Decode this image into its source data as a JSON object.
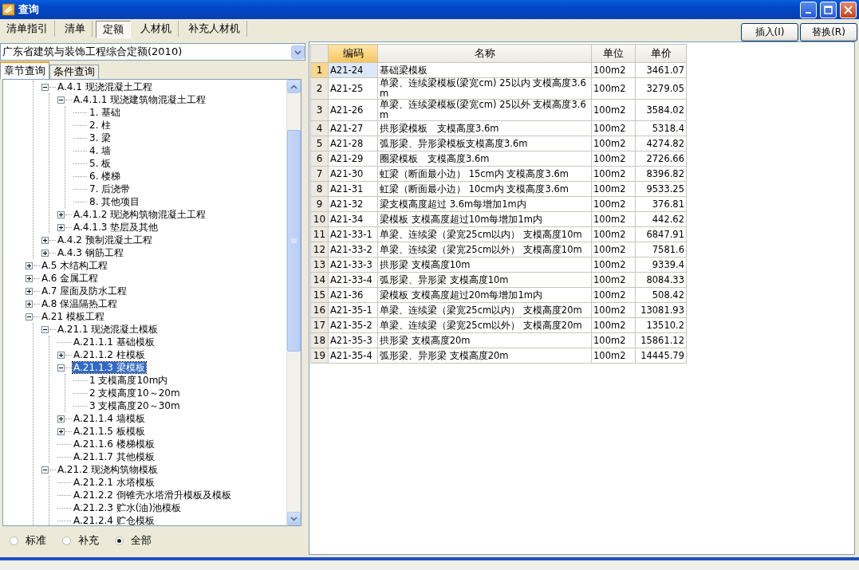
{
  "window": {
    "title": "查询"
  },
  "top_tabs": [
    {
      "label": "清单指引",
      "selected": false
    },
    {
      "label": "清单",
      "selected": false
    },
    {
      "label": "定额",
      "selected": true
    },
    {
      "label": "人材机",
      "selected": false
    },
    {
      "label": "补充人材机",
      "selected": false
    }
  ],
  "buttons": [
    "插入(I)",
    "替换(R)"
  ],
  "quota_dropdown": {
    "value": "广东省建筑与装饰工程综合定额(2010)"
  },
  "sub_tabs": [
    {
      "label": "章节查询",
      "selected": true
    },
    {
      "label": "条件查询",
      "selected": false
    }
  ],
  "tree": {
    "items": [
      {
        "children": [
          {
            "label": "A.4.1 现浇混凝土工程",
            "expanded": true,
            "selected": false,
            "children": [
              {
                "label": "A.4.1.1 现浇建筑物混凝土工程",
                "expanded": true,
                "selected": false,
                "children": [
                  {
                    "label": "1. 基础",
                    "selected": false
                  },
                  {
                    "label": "2. 柱",
                    "selected": false
                  },
                  {
                    "label": "3. 梁",
                    "selected": false
                  },
                  {
                    "label": "4. 墙",
                    "selected": false
                  },
                  {
                    "label": "5. 板",
                    "selected": false
                  },
                  {
                    "label": "6. 楼梯",
                    "selected": false
                  },
                  {
                    "label": "7. 后浇带",
                    "selected": false
                  },
                  {
                    "label": "8. 其他项目",
                    "selected": false
                  }
                ]
              },
              {
                "label": "A.4.1.2 现浇构筑物混凝土工程",
                "expanded": false,
                "selected": false
              },
              {
                "label": "A.4.1.3 垫层及其他",
                "expanded": false,
                "selected": false
              }
            ]
          },
          {
            "label": "A.4.2 预制混凝土工程",
            "expanded": false,
            "selected": false
          },
          {
            "label": "A.4.3 钢筋工程",
            "expanded": false,
            "selected": false
          }
        ]
      },
      {
        "label": "A.5 木结构工程",
        "expanded": false,
        "selected": false
      },
      {
        "label": "A.6 金属工程",
        "expanded": false,
        "selected": false
      },
      {
        "label": "A.7 屋面及防水工程",
        "expanded": false,
        "selected": false
      },
      {
        "label": "A.8 保温隔热工程",
        "expanded": false,
        "selected": false
      },
      {
        "label": "A.21 模板工程",
        "expanded": true,
        "selected": false,
        "children": [
          {
            "label": "A.21.1 现浇混凝土模板",
            "expanded": true,
            "selected": false,
            "children": [
              {
                "label": "A.21.1.1 基础模板",
                "selected": false
              },
              {
                "label": "A.21.1.2 柱模板",
                "expanded": false,
                "selected": false
              },
              {
                "label": "A.21.1.3 梁模板",
                "expanded": true,
                "selected": true,
                "children": [
                  {
                    "label": "1 支模高度10m内",
                    "selected": false
                  },
                  {
                    "label": "2 支模高度10～20m",
                    "selected": false
                  },
                  {
                    "label": "3 支模高度20～30m",
                    "selected": false
                  }
                ]
              },
              {
                "label": "A.21.1.4 墙模板",
                "expanded": false,
                "selected": false
              },
              {
                "label": "A.21.1.5 板模板",
                "expanded": false,
                "selected": false
              },
              {
                "label": "A.21.1.6 楼梯模板",
                "selected": false
              },
              {
                "label": "A.21.1.7 其他模板",
                "selected": false
              }
            ]
          },
          {
            "label": "A.21.2 现浇构筑物模板",
            "expanded": true,
            "selected": false,
            "children": [
              {
                "label": "A.21.2.1 水塔模板",
                "selected": false
              },
              {
                "label": "A.21.2.2 倒锥壳水塔滑升模板及模板",
                "selected": false
              },
              {
                "label": "A.21.2.3 贮水(油)池模板",
                "selected": false
              },
              {
                "label": "A.21.2.4 贮仓模板",
                "selected": false
              }
            ]
          }
        ]
      }
    ]
  },
  "filter_radios": [
    {
      "label": "标准",
      "selected": false
    },
    {
      "label": "补充",
      "selected": false
    },
    {
      "label": "全部",
      "selected": true
    }
  ],
  "table": {
    "columns": [
      {
        "label": "编码",
        "selected": true
      },
      {
        "label": "名称",
        "selected": false
      },
      {
        "label": "单位",
        "selected": false
      },
      {
        "label": "单价",
        "selected": false
      }
    ],
    "rows": [
      {
        "no": "1",
        "code": "A21-24",
        "name": "基础梁模板",
        "unit": "100m2",
        "price": "3461.07",
        "selected": true
      },
      {
        "no": "2",
        "code": "A21-25",
        "name": "单梁、连续梁模板(梁宽cm) 25以内 支模高度3.6m",
        "unit": "100m2",
        "price": "3279.05",
        "selected": false
      },
      {
        "no": "3",
        "code": "A21-26",
        "name": "单梁、连续梁模板(梁宽cm) 25以外 支模高度3.6m",
        "unit": "100m2",
        "price": "3584.02",
        "selected": false
      },
      {
        "no": "4",
        "code": "A21-27",
        "name": "拱形梁模板　支模高度3.6m",
        "unit": "100m2",
        "price": "5318.4",
        "selected": false
      },
      {
        "no": "5",
        "code": "A21-28",
        "name": "弧形梁、异形梁模板支模高度3.6m",
        "unit": "100m2",
        "price": "4274.82",
        "selected": false
      },
      {
        "no": "6",
        "code": "A21-29",
        "name": "圈梁模板　支模高度3.6m",
        "unit": "100m2",
        "price": "2726.66",
        "selected": false
      },
      {
        "no": "7",
        "code": "A21-30",
        "name": "虹梁（断面最小边） 15cm内 支模高度3.6m",
        "unit": "100m2",
        "price": "8396.82",
        "selected": false
      },
      {
        "no": "8",
        "code": "A21-31",
        "name": "虹梁（断面最小边） 10cm内 支模高度3.6m",
        "unit": "100m2",
        "price": "9533.25",
        "selected": false
      },
      {
        "no": "9",
        "code": "A21-32",
        "name": "梁支模高度超过 3.6m每增加1m内",
        "unit": "100m2",
        "price": "376.81",
        "selected": false
      },
      {
        "no": "10",
        "code": "A21-34",
        "name": "梁模板 支模高度超过10m每增加1m内",
        "unit": "100m2",
        "price": "442.62",
        "selected": false
      },
      {
        "no": "11",
        "code": "A21-33-1",
        "name": "单梁、连续梁（梁宽25cm以内） 支模高度10m",
        "unit": "100m2",
        "price": "6847.91",
        "selected": false
      },
      {
        "no": "12",
        "code": "A21-33-2",
        "name": "单梁、连续梁（梁宽25cm以外） 支模高度10m",
        "unit": "100m2",
        "price": "7581.6",
        "selected": false
      },
      {
        "no": "13",
        "code": "A21-33-3",
        "name": "拱形梁 支模高度10m",
        "unit": "100m2",
        "price": "9339.4",
        "selected": false
      },
      {
        "no": "14",
        "code": "A21-33-4",
        "name": "弧形梁、异形梁 支模高度10m",
        "unit": "100m2",
        "price": "8084.33",
        "selected": false
      },
      {
        "no": "15",
        "code": "A21-36",
        "name": "梁模板 支模高度超过20m每增加1m内",
        "unit": "100m2",
        "price": "508.42",
        "selected": false
      },
      {
        "no": "16",
        "code": "A21-35-1",
        "name": "单梁、连续梁（梁宽25cm以内） 支模高度20m",
        "unit": "100m2",
        "price": "13081.93",
        "selected": false
      },
      {
        "no": "17",
        "code": "A21-35-2",
        "name": "单梁、连续梁（梁宽25cm以外） 支模高度20m",
        "unit": "100m2",
        "price": "13510.2",
        "selected": false
      },
      {
        "no": "18",
        "code": "A21-35-3",
        "name": "拱形梁 支模高度20m",
        "unit": "100m2",
        "price": "15861.12",
        "selected": false
      },
      {
        "no": "19",
        "code": "A21-35-4",
        "name": "弧形梁、异形梁 支模高度20m",
        "unit": "100m2",
        "price": "14445.79",
        "selected": false
      }
    ]
  }
}
